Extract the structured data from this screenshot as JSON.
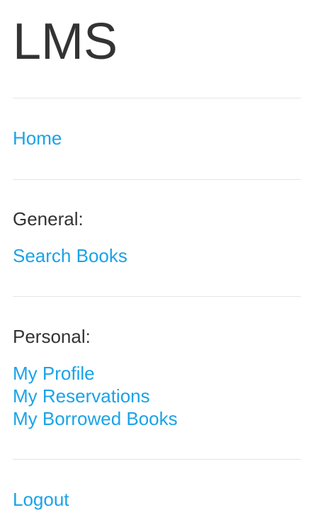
{
  "app": {
    "title": "LMS"
  },
  "nav": {
    "home": "Home",
    "general": {
      "label": "General:",
      "items": [
        "Search Books"
      ]
    },
    "personal": {
      "label": "Personal:",
      "items": [
        "My Profile",
        "My Reservations",
        "My Borrowed Books"
      ]
    },
    "logout": "Logout"
  },
  "colors": {
    "link": "#1aa3e8",
    "text": "#333333",
    "divider": "#e5e5e5",
    "background": "#ffffff"
  }
}
